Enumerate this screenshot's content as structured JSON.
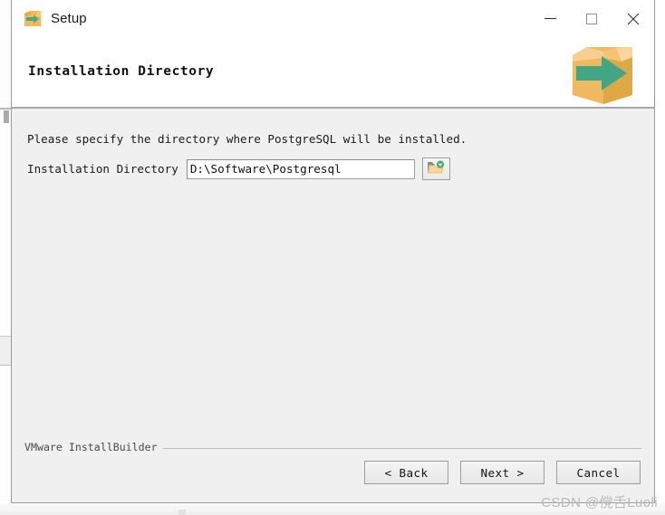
{
  "window": {
    "title": "Setup",
    "title_icon": "installbuilder-box-arrow-icon",
    "controls": {
      "minimize": "minimize-icon",
      "maximize": "maximize-icon",
      "close": "close-icon"
    }
  },
  "header": {
    "title": "Installation Directory",
    "logo": "installbuilder-box-arrow-logo"
  },
  "main": {
    "intro_text": "Please specify the directory where PostgreSQL will be installed.",
    "directory_label": "Installation Directory",
    "directory_value": "D:\\Software\\Postgresql",
    "directory_placeholder": "",
    "browse_icon": "folder-open-icon"
  },
  "footer": {
    "brand": "VMware InstallBuilder",
    "buttons": [
      {
        "name": "back-button",
        "label": "< Back"
      },
      {
        "name": "next-button",
        "label": "Next >"
      },
      {
        "name": "cancel-button",
        "label": "Cancel"
      }
    ]
  },
  "watermark": {
    "text": "CSDN @傥舌Luoli"
  },
  "colors": {
    "window_body": "#f0f0f0",
    "header_band": "#ffffff",
    "logo_box": "#edb35a",
    "logo_arrow": "#45ab84",
    "text": "#1a1a1a",
    "border": "#9a9a9a"
  }
}
